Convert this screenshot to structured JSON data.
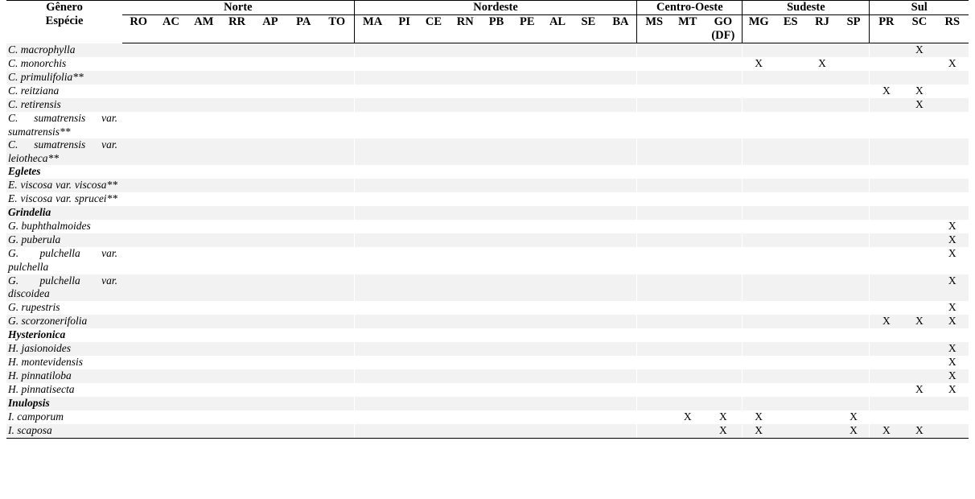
{
  "header": {
    "corner_line1": "Gênero",
    "corner_line2": "Espécie",
    "groups": [
      {
        "label": "Norte",
        "cols": [
          "RO",
          "AC",
          "AM",
          "RR",
          "AP",
          "PA",
          "TO"
        ]
      },
      {
        "label": "Nordeste",
        "cols": [
          "MA",
          "PI",
          "CE",
          "RN",
          "PB",
          "PE",
          "AL",
          "SE",
          "BA"
        ]
      },
      {
        "label": "Centro-Oeste",
        "cols": [
          "MS",
          "MT",
          "GO"
        ],
        "col_sub": {
          "GO": "(DF)"
        }
      },
      {
        "label": "Sudeste",
        "cols": [
          "MG",
          "ES",
          "RJ",
          "SP"
        ]
      },
      {
        "label": "Sul",
        "cols": [
          "PR",
          "SC",
          "RS"
        ]
      }
    ]
  },
  "columns": [
    "RO",
    "AC",
    "AM",
    "RR",
    "AP",
    "PA",
    "TO",
    "MA",
    "PI",
    "CE",
    "RN",
    "PB",
    "PE",
    "AL",
    "SE",
    "BA",
    "MS",
    "MT",
    "GO",
    "MG",
    "ES",
    "RJ",
    "SP",
    "PR",
    "SC",
    "RS"
  ],
  "mark": "X",
  "rows": [
    {
      "name": "C. macrophylla",
      "type": "species",
      "marks": [
        "SC"
      ]
    },
    {
      "name": "C. monorchis",
      "type": "species",
      "marks": [
        "MG",
        "RJ",
        "RS"
      ]
    },
    {
      "name": "C. primulifolia**",
      "type": "species",
      "marks": []
    },
    {
      "name": "C. reitziana",
      "type": "species",
      "marks": [
        "PR",
        "SC"
      ]
    },
    {
      "name": "C. retirensis",
      "type": "species",
      "marks": [
        "SC"
      ]
    },
    {
      "name": "C. sumatrensis var. sumatrensis**",
      "type": "species",
      "two_line": true,
      "marks": []
    },
    {
      "name": "C. sumatrensis var. leiotheca**",
      "type": "species",
      "two_line": true,
      "marks": []
    },
    {
      "name": "Egletes",
      "type": "genus",
      "marks": []
    },
    {
      "name": "E. viscosa var. viscosa**",
      "type": "species",
      "two_line": true,
      "marks": []
    },
    {
      "name": "E. viscosa var. sprucei**",
      "type": "species",
      "two_line": true,
      "marks": []
    },
    {
      "name": "Grindelia",
      "type": "genus",
      "marks": []
    },
    {
      "name": "G. buphthalmoides",
      "type": "species",
      "marks": [
        "RS"
      ]
    },
    {
      "name": "G. puberula",
      "type": "species",
      "marks": [
        "RS"
      ]
    },
    {
      "name": "G. pulchella var. pulchella",
      "type": "species",
      "two_line": true,
      "marks": [
        "RS"
      ]
    },
    {
      "name": "G. pulchella var. discoidea",
      "type": "species",
      "two_line": true,
      "marks": [
        "RS"
      ]
    },
    {
      "name": "G. rupestris",
      "type": "species",
      "marks": [
        "RS"
      ]
    },
    {
      "name": "G. scorzonerifolia",
      "type": "species",
      "marks": [
        "PR",
        "SC",
        "RS"
      ]
    },
    {
      "name": "Hysterionica",
      "type": "genus",
      "marks": []
    },
    {
      "name": "H. jasionoides",
      "type": "species",
      "marks": [
        "RS"
      ]
    },
    {
      "name": "H. montevidensis",
      "type": "species",
      "marks": [
        "RS"
      ]
    },
    {
      "name": "H. pinnatiloba",
      "type": "species",
      "marks": [
        "RS"
      ]
    },
    {
      "name": "H. pinnatisecta",
      "type": "species",
      "marks": [
        "SC",
        "RS"
      ]
    },
    {
      "name": "Inulopsis",
      "type": "genus",
      "marks": []
    },
    {
      "name": "I. camporum",
      "type": "species",
      "marks": [
        "MT",
        "GO",
        "MG",
        "SP"
      ]
    },
    {
      "name": "I. scaposa",
      "type": "species",
      "marks": [
        "GO",
        "MG",
        "SP",
        "PR",
        "SC"
      ]
    }
  ]
}
